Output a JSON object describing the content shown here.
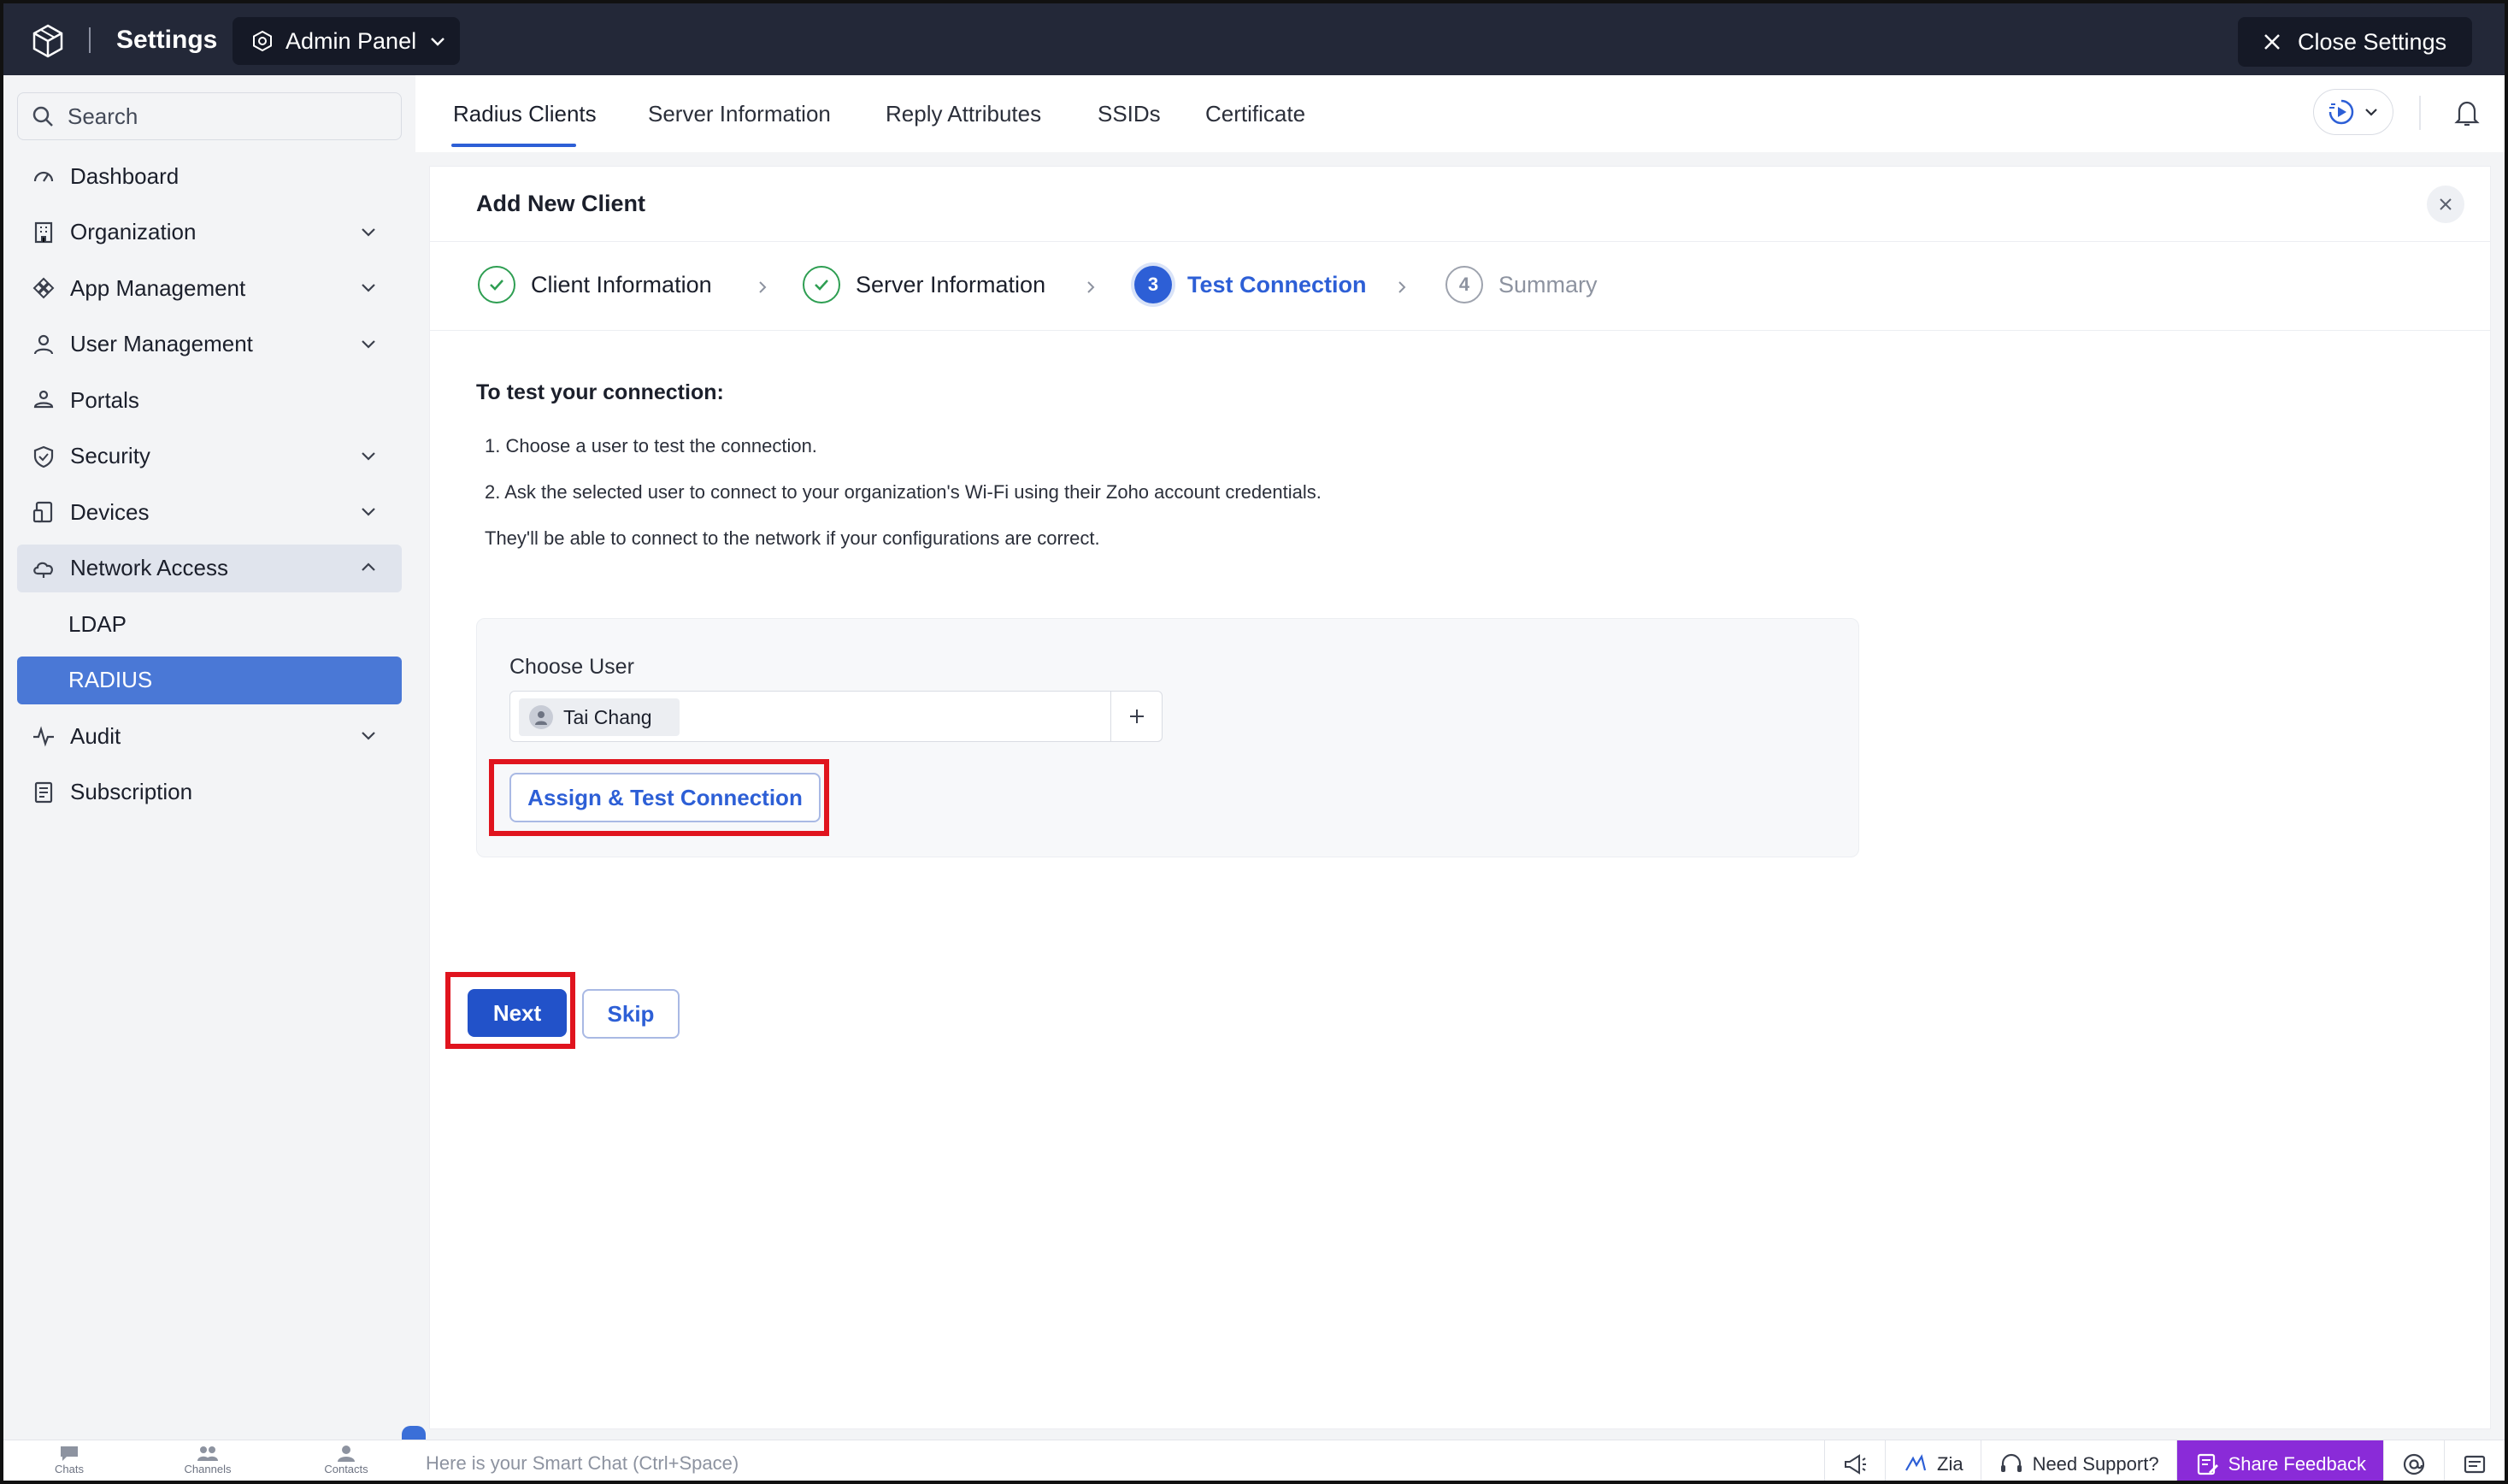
{
  "header": {
    "title": "Settings",
    "panel_selector": "Admin Panel",
    "close_label": "Close Settings"
  },
  "sidebar": {
    "search_placeholder": "Search",
    "items": [
      {
        "label": "Dashboard",
        "icon": "gauge-icon"
      },
      {
        "label": "Organization",
        "icon": "building-icon"
      },
      {
        "label": "App Management",
        "icon": "apps-icon"
      },
      {
        "label": "User Management",
        "icon": "user-icon"
      },
      {
        "label": "Portals",
        "icon": "portal-icon"
      },
      {
        "label": "Security",
        "icon": "shield-icon"
      },
      {
        "label": "Devices",
        "icon": "devices-icon"
      },
      {
        "label": "Network Access",
        "icon": "cloud-icon"
      },
      {
        "label": "LDAP"
      },
      {
        "label": "RADIUS"
      },
      {
        "label": "Audit",
        "icon": "pulse-icon"
      },
      {
        "label": "Subscription",
        "icon": "receipt-icon"
      }
    ]
  },
  "tabs": [
    "Radius Clients",
    "Server Information",
    "Reply Attributes",
    "SSIDs",
    "Certificate"
  ],
  "panel": {
    "title": "Add New Client",
    "steps": [
      {
        "label": "Client Information",
        "state": "done"
      },
      {
        "label": "Server Information",
        "state": "done"
      },
      {
        "number": "3",
        "label": "Test Connection",
        "state": "current"
      },
      {
        "number": "4",
        "label": "Summary",
        "state": "todo"
      }
    ],
    "heading": "To test your connection:",
    "instructions": [
      "1. Choose a user to test the connection.",
      "2. Ask the selected user to connect to your organization's Wi-Fi using their Zoho account credentials.",
      "They'll be able to connect to the network if your configurations are correct."
    ],
    "choose_label": "Choose User",
    "selected_user": "Tai Chang",
    "assign_label": "Assign & Test Connection",
    "next_label": "Next",
    "skip_label": "Skip"
  },
  "bottombar": {
    "apps": [
      "Chats",
      "Channels",
      "Contacts"
    ],
    "smart_chat": "Here is your Smart Chat (Ctrl+Space)",
    "zia": "Zia",
    "support": "Need Support?",
    "feedback": "Share Feedback"
  },
  "colors": {
    "accent": "#2d5fd6",
    "active_nav": "#4a78d6",
    "highlight": "#e0141e",
    "topbar": "#232838",
    "feedback": "#8a2bd8"
  }
}
